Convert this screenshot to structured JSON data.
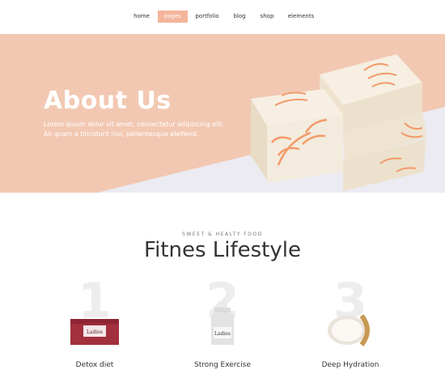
{
  "nav": {
    "items": [
      {
        "label": "home"
      },
      {
        "label": "pages"
      },
      {
        "label": "portfolio"
      },
      {
        "label": "blog"
      },
      {
        "label": "shop"
      },
      {
        "label": "elements"
      }
    ],
    "active_color": "#f4b59c"
  },
  "hero": {
    "title": "About Us",
    "text": "Lorem ipsum dolor sit amet, consectetur adipiscing elit. Ali quam a tincidunt nisi, pellentesque eleifend.",
    "bg_color": "#f2c8b2",
    "accent_color": "#f39a6a"
  },
  "section": {
    "kicker": "SWEET & HEALTY FOOD",
    "title": "Fitnes Lifestyle"
  },
  "features": [
    {
      "number": "1",
      "label": "Detox diet",
      "product": "Ladies"
    },
    {
      "number": "2",
      "label": "Strong Exercise",
      "product": "Ladies"
    },
    {
      "number": "3",
      "label": "Deep Hydration"
    }
  ]
}
